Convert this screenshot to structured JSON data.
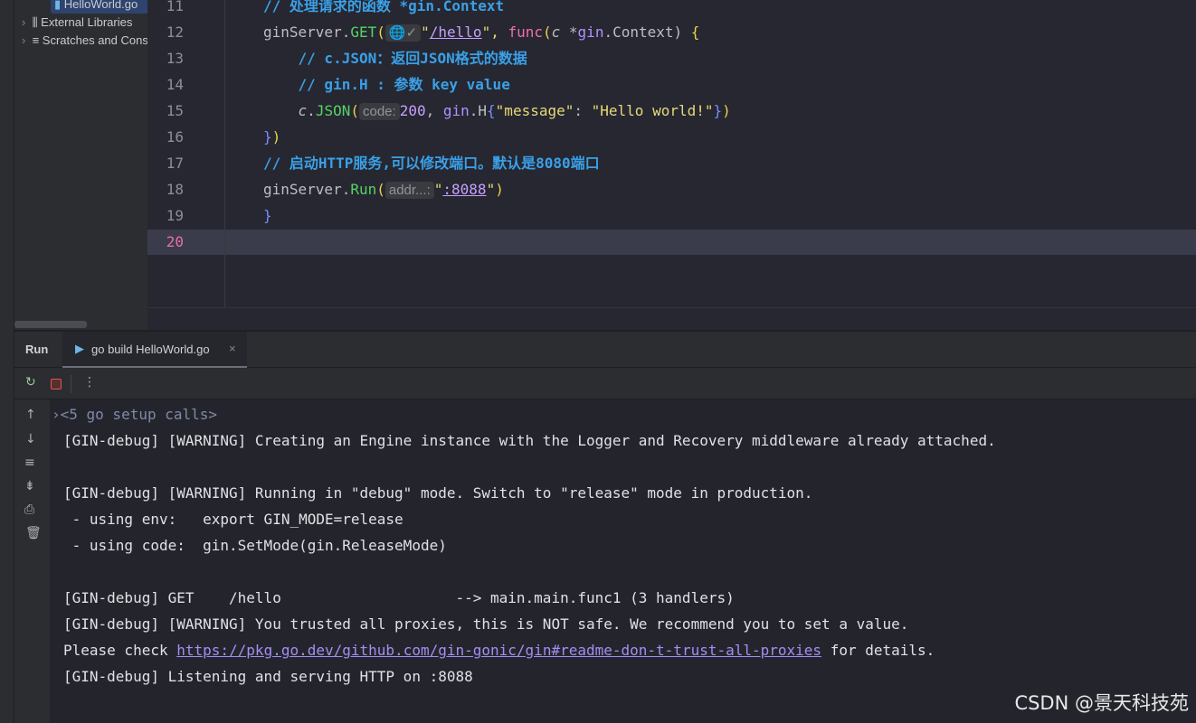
{
  "project_tree": {
    "items": [
      {
        "label": "HelloWorld.go",
        "selected": true
      },
      {
        "label": "External Libraries"
      },
      {
        "label": "Scratches and Consoles"
      }
    ]
  },
  "editor": {
    "current_line": 20,
    "lines": [
      {
        "n": "11",
        "tokens": [
          [
            "// 处理请求的函数 *gin.Context",
            "c"
          ]
        ]
      },
      {
        "n": "12",
        "tokens": [
          [
            "ginServer.",
            "p"
          ],
          [
            "GET",
            "f"
          ],
          [
            "(",
            "b"
          ],
          [
            "🌐✓",
            "hint"
          ],
          [
            "\"",
            "s"
          ],
          [
            "/hello",
            "u"
          ],
          [
            "\", ",
            "s"
          ],
          [
            "func",
            "k"
          ],
          [
            "(",
            "b"
          ],
          [
            "c",
            "i"
          ],
          [
            " *",
            "p"
          ],
          [
            "gin",
            "h"
          ],
          [
            ".Context) ",
            "p"
          ],
          [
            "{",
            "b"
          ]
        ]
      },
      {
        "n": "13",
        "tokens": [
          [
            "    // c.JSON：返回JSON格式的数据",
            "c"
          ]
        ]
      },
      {
        "n": "14",
        "tokens": [
          [
            "    // gin.H : 参数 key value",
            "c"
          ]
        ]
      },
      {
        "n": "15",
        "tokens": [
          [
            "    ",
            "p"
          ],
          [
            "c",
            "i"
          ],
          [
            ".",
            "p"
          ],
          [
            "JSON",
            "f"
          ],
          [
            "(",
            "b"
          ],
          [
            "code:",
            "hint"
          ],
          [
            "200",
            "n"
          ],
          [
            ", ",
            "p"
          ],
          [
            "gin",
            "h"
          ],
          [
            ".H",
            "p"
          ],
          [
            "{",
            "bb"
          ],
          [
            "\"message\"",
            "s"
          ],
          [
            ": ",
            "p"
          ],
          [
            "\"Hello world!\"",
            "s"
          ],
          [
            "}",
            "bb"
          ],
          [
            ")",
            "b"
          ]
        ]
      },
      {
        "n": "16",
        "tokens": [
          [
            "}",
            "bb"
          ],
          [
            ")",
            "b"
          ]
        ]
      },
      {
        "n": "17",
        "tokens": [
          [
            "// 启动HTTP服务,可以修改端口。默认是8080端口",
            "c"
          ]
        ]
      },
      {
        "n": "18",
        "tokens": [
          [
            "ginServer.",
            "p"
          ],
          [
            "Run",
            "f"
          ],
          [
            "(",
            "b"
          ],
          [
            "addr...:",
            "hint"
          ],
          [
            "\"",
            "s"
          ],
          [
            ":8088",
            "u"
          ],
          [
            "\"",
            "s"
          ],
          [
            ")",
            "b"
          ]
        ]
      },
      {
        "n": "19",
        "tokens": [
          [
            "}",
            "bb"
          ]
        ]
      },
      {
        "n": "20",
        "tokens": []
      }
    ]
  },
  "run_panel": {
    "title": "Run",
    "tab_label": "go build HelloWorld.go",
    "console": [
      {
        "text": "<5 go setup calls>",
        "folded": true
      },
      {
        "text": "[GIN-debug] [WARNING] Creating an Engine instance with the Logger and Recovery middleware already attached."
      },
      {
        "text": ""
      },
      {
        "text": "[GIN-debug] [WARNING] Running in \"debug\" mode. Switch to \"release\" mode in production."
      },
      {
        "text": " - using env:   export GIN_MODE=release"
      },
      {
        "text": " - using code:  gin.SetMode(gin.ReleaseMode)"
      },
      {
        "text": ""
      },
      {
        "text": "[GIN-debug] GET    /hello                    --> main.main.func1 (3 handlers)"
      },
      {
        "text": "[GIN-debug] [WARNING] You trusted all proxies, this is NOT safe. We recommend you to set a value."
      },
      {
        "text": "Please check ",
        "link": "https://pkg.go.dev/github.com/gin-gonic/gin#readme-don-t-trust-all-proxies",
        "after": " for details."
      },
      {
        "text": "[GIN-debug] Listening and serving HTTP on :8088"
      }
    ]
  },
  "watermark": "CSDN @景天科技苑"
}
